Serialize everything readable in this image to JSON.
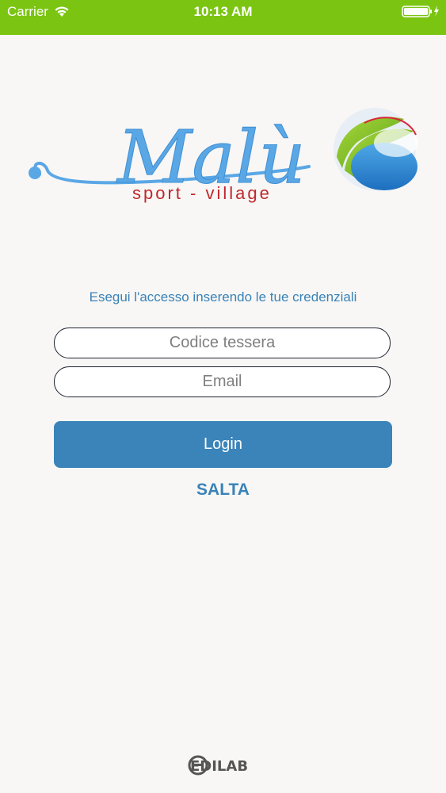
{
  "status_bar": {
    "carrier": "Carrier",
    "time": "10:13 AM",
    "background_color": "#7bc512",
    "wifi_icon": "wifi-icon",
    "battery_icon": "battery-charging-icon"
  },
  "logo": {
    "brand_name": "Malù",
    "tagline": "sport - village"
  },
  "login": {
    "prompt": "Esegui l'accesso inserendo le tue credenziali",
    "codice_placeholder": "Codice tessera",
    "codice_value": "",
    "email_placeholder": "Email",
    "email_value": "",
    "login_label": "Login",
    "skip_label": "SALTA",
    "accent_color": "#3a84ba"
  },
  "footer": {
    "brand": "EDILAB"
  }
}
